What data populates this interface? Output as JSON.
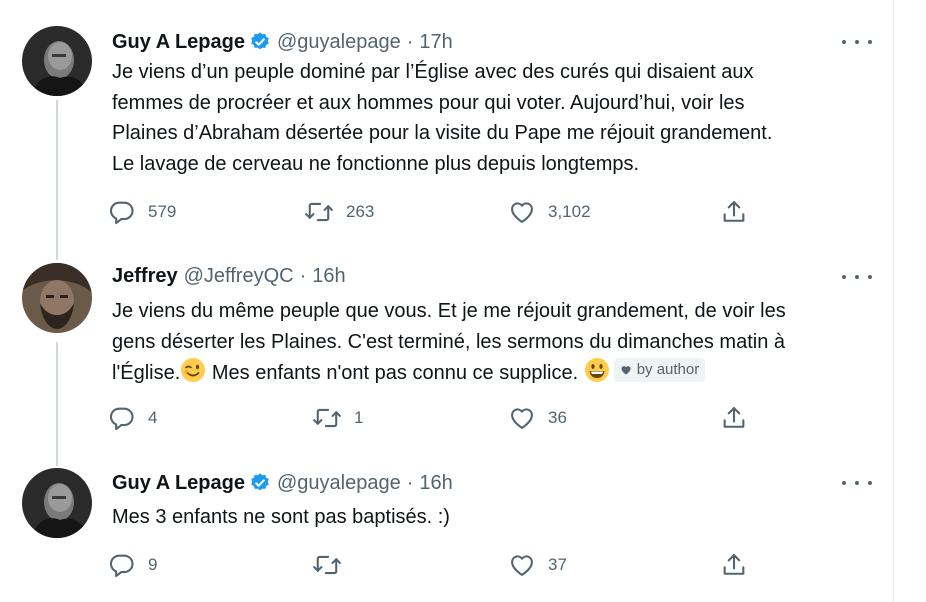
{
  "tweets": [
    {
      "name": "Guy A Lepage",
      "verified": true,
      "handle": "@guyalepage",
      "separator": "·",
      "time": "17h",
      "text_lines": [
        "Je viens d’un peuple dominé par l’Église avec des curés qui disaient aux",
        "femmes de procréer et aux hommes pour qui voter. Aujourd’hui, voir les",
        "Plaines d’Abraham désertée pour la visite du Pape me réjouit grandement.",
        "Le lavage de cerveau ne fonctionne plus depuis longtemps."
      ],
      "replies": "579",
      "retweets": "263",
      "likes": "3,102"
    },
    {
      "name": "Jeffrey",
      "verified": false,
      "handle": "@JeffreyQC",
      "separator": "·",
      "time": "16h",
      "text_lines": [
        "Je viens du même peuple que vous. Et je me réjouit grandement, de voir les",
        "gens déserter les Plaines. C'est terminé, les sermons du dimanches matin à"
      ],
      "text_line3_a": "l'Église.",
      "text_line3_b": " Mes enfants n'ont pas connu ce supplice. ",
      "badge_label": "by author",
      "replies": "4",
      "retweets": "1",
      "likes": "36"
    },
    {
      "name": "Guy A Lepage",
      "verified": true,
      "handle": "@guyalepage",
      "separator": "·",
      "time": "16h",
      "text_lines": [
        "Mes 3 enfants ne sont pas baptisés. :)"
      ],
      "replies": "9",
      "retweets": "",
      "likes": "37"
    }
  ],
  "icons": {
    "reply": "reply-icon",
    "retweet": "retweet-icon",
    "like": "heart-icon",
    "share": "share-icon",
    "more": "more-icon",
    "verified": "verified-badge-icon",
    "wink": "winking-face-emoji",
    "smile": "grinning-face-emoji",
    "heart_badge": "heart-icon"
  },
  "colors": {
    "text": "#0f1419",
    "secondary": "#536471",
    "verified": "#1d9bf0",
    "thread_line": "#cfd9de"
  }
}
